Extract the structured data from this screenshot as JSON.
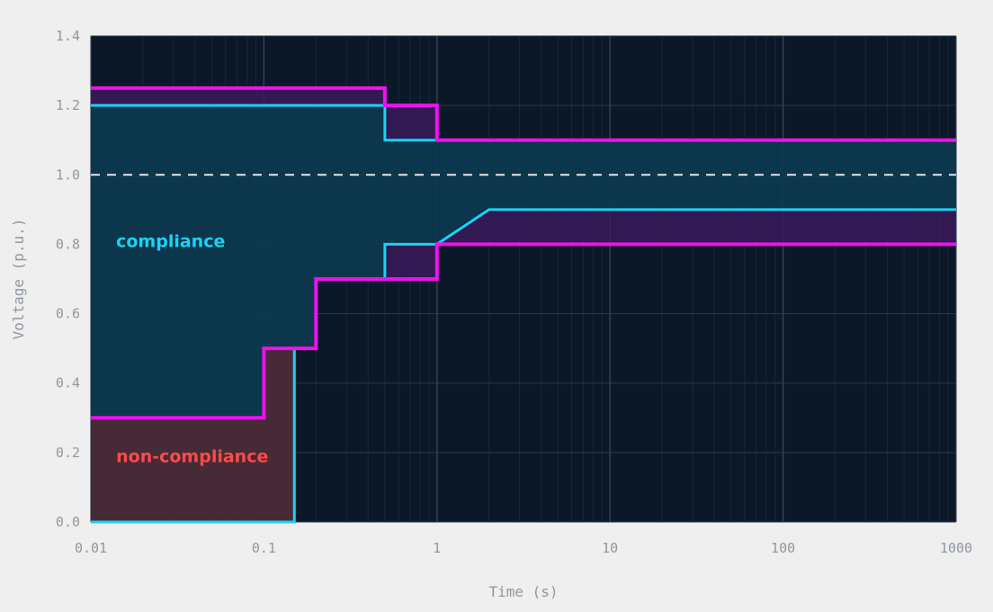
{
  "chart_data": {
    "type": "line",
    "title": "",
    "xlabel": "Time (s)",
    "ylabel": "Voltage (p.u.)",
    "x_scale": "log",
    "xlim": [
      0.01,
      1000
    ],
    "ylim": [
      0,
      1.4
    ],
    "x_ticks": [
      0.01,
      0.1,
      1,
      10,
      100,
      1000
    ],
    "x_tick_labels": [
      "0.01",
      "0.1",
      "1",
      "10",
      "100",
      "1000"
    ],
    "y_ticks": [
      0.0,
      0.2,
      0.4,
      0.6,
      0.8,
      1.0,
      1.2,
      1.4
    ],
    "y_tick_labels": [
      "0.0",
      "0.2",
      "0.4",
      "0.6",
      "0.8",
      "1.0",
      "1.2",
      "1.4"
    ],
    "grid": true,
    "reference_line": {
      "y": 1.0,
      "style": "dashed",
      "color": "#e6e6e6"
    },
    "colors": {
      "plot_background": "#0b1828",
      "page_background": "#efefef",
      "series_a": "#19d3f5",
      "series_b": "#ee11ee",
      "compliance_fill": "#0b3a50",
      "non_compliance_fill": "#4a2a35",
      "band_fill": "#3a1a5a"
    },
    "series": [
      {
        "id": "cyan-upper",
        "color": "#19d3f5",
        "step_points": [
          [
            0.01,
            1.2
          ],
          [
            0.5,
            1.2
          ],
          [
            0.5,
            1.1
          ],
          [
            1000,
            1.1
          ]
        ]
      },
      {
        "id": "cyan-lower",
        "color": "#19d3f5",
        "step_points": [
          [
            0.01,
            0.0
          ],
          [
            0.15,
            0.0
          ],
          [
            0.15,
            0.5
          ],
          [
            0.2,
            0.5
          ],
          [
            0.2,
            0.7
          ],
          [
            0.5,
            0.7
          ],
          [
            0.5,
            0.8
          ],
          [
            1,
            0.8
          ],
          [
            2,
            0.9
          ],
          [
            1000,
            0.9
          ]
        ]
      },
      {
        "id": "magenta-upper",
        "color": "#ee11ee",
        "step_points": [
          [
            0.01,
            1.25
          ],
          [
            0.5,
            1.25
          ],
          [
            0.5,
            1.2
          ],
          [
            1,
            1.2
          ],
          [
            1,
            1.1
          ],
          [
            1000,
            1.1
          ]
        ]
      },
      {
        "id": "magenta-lower",
        "color": "#ee11ee",
        "step_points": [
          [
            0.01,
            0.3
          ],
          [
            0.1,
            0.3
          ],
          [
            0.1,
            0.5
          ],
          [
            0.2,
            0.5
          ],
          [
            0.2,
            0.7
          ],
          [
            1,
            0.7
          ],
          [
            1,
            0.8
          ],
          [
            1000,
            0.8
          ]
        ]
      }
    ],
    "annotations": [
      {
        "text": "compliance",
        "color": "#19d3f5",
        "x": 0.014,
        "y": 0.81
      },
      {
        "text": "non-compliance",
        "color": "#ff4a4a",
        "x": 0.014,
        "y": 0.19
      }
    ]
  }
}
